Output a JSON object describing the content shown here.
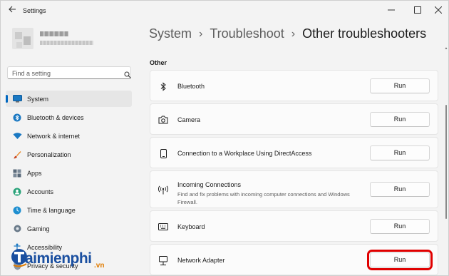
{
  "app": {
    "title": "Settings"
  },
  "search": {
    "placeholder": "Find a setting"
  },
  "sidebar": {
    "items": [
      {
        "label": "System",
        "icon": "monitor-icon",
        "active": true
      },
      {
        "label": "Bluetooth & devices",
        "icon": "bluetooth-icon"
      },
      {
        "label": "Network & internet",
        "icon": "wifi-icon"
      },
      {
        "label": "Personalization",
        "icon": "brush-icon"
      },
      {
        "label": "Apps",
        "icon": "apps-icon"
      },
      {
        "label": "Accounts",
        "icon": "person-icon"
      },
      {
        "label": "Time & language",
        "icon": "globe-clock-icon"
      },
      {
        "label": "Gaming",
        "icon": "gamepad-icon"
      },
      {
        "label": "Accessibility",
        "icon": "accessibility-icon"
      },
      {
        "label": "Privacy & security",
        "icon": "shield-icon"
      }
    ]
  },
  "breadcrumb": {
    "items": [
      "System",
      "Troubleshoot",
      "Other troubleshooters"
    ]
  },
  "main": {
    "section_label": "Other",
    "troubleshooters": [
      {
        "title": "Bluetooth",
        "icon": "bluetooth-icon",
        "button": "Run"
      },
      {
        "title": "Camera",
        "icon": "camera-icon",
        "button": "Run"
      },
      {
        "title": "Connection to a Workplace Using DirectAccess",
        "icon": "phone-icon",
        "button": "Run"
      },
      {
        "title": "Incoming Connections",
        "description": "Find and fix problems with incoming computer connections and Windows Firewall.",
        "icon": "signal-icon",
        "button": "Run"
      },
      {
        "title": "Keyboard",
        "icon": "keyboard-icon",
        "button": "Run"
      },
      {
        "title": "Network Adapter",
        "icon": "network-pc-icon",
        "button": "Run",
        "highlighted": true
      }
    ]
  },
  "watermark": {
    "text": "aimienphi",
    "suffix": ".vn"
  },
  "colors": {
    "accent": "#0067c0",
    "highlight": "#e00000",
    "background": "#f3f3f3",
    "card": "#fbfbfb"
  }
}
